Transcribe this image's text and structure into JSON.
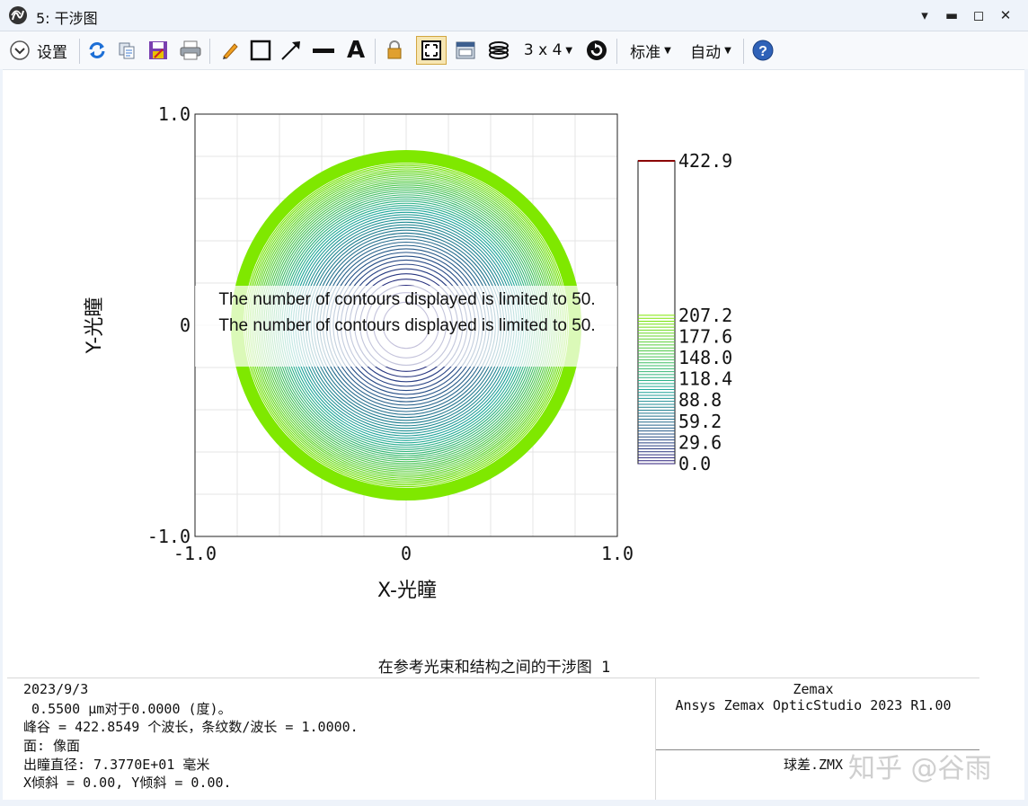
{
  "window": {
    "title": "5: 干涉图",
    "controls": [
      "chevron-down",
      "minimize",
      "maximize",
      "close"
    ]
  },
  "toolbar": {
    "settings_label": "设置",
    "layout_label": "3 x 4",
    "standard_label": "标准",
    "auto_label": "自动",
    "icons": [
      "refresh-icon",
      "copy-icon",
      "save-icon",
      "print-icon",
      "pencil-icon",
      "rectangle-icon",
      "arrow-icon",
      "line-icon",
      "text-icon",
      "lock-icon",
      "zoom-fit-icon",
      "window-icon",
      "layers-icon",
      "rotate-icon",
      "help-icon"
    ]
  },
  "plot": {
    "notice_line1": "The number of contours displayed is limited to 50.",
    "notice_line2": "The number of contours displayed is limited to 50.",
    "colors": {
      "low": "#2b1b7a",
      "mid": "#1fa89a",
      "high": "#7fe800",
      "top": "#8b0000"
    }
  },
  "chart_data": {
    "type": "contour",
    "xlabel": "X-光瞳",
    "ylabel": "Y-光瞳",
    "xlim": [
      -1.0,
      1.0
    ],
    "ylim": [
      -1.0,
      1.0
    ],
    "xticks": [
      "-1.0",
      "0",
      "1.0"
    ],
    "yticks": [
      "1.0",
      "0",
      "-1.0"
    ],
    "legend_values": [
      "422.9",
      "207.2",
      "177.6",
      "148.0",
      "118.4",
      "88.8",
      "59.2",
      "29.6",
      "0.0"
    ],
    "legend_max": 422.9,
    "contour_count": 50,
    "aperture_radius": 0.83
  },
  "footer": {
    "plot_title": "在参考光束和结构之间的干涉图 1",
    "date": "2023/9/3",
    "line2": " 0.5500 µm对于0.0000 (度)。",
    "line3": "峰谷 = 422.8549 个波长，条纹数/波长 = 1.0000.",
    "line4": "面: 像面",
    "line5": "出瞳直径: 7.3770E+01 毫米",
    "line6": "X倾斜 = 0.00, Y倾斜 = 0.00.",
    "company": "Zemax",
    "product": "Ansys Zemax OpticStudio 2023 R1.00",
    "file": "球差.ZMX"
  },
  "watermark": "知乎 @谷雨"
}
